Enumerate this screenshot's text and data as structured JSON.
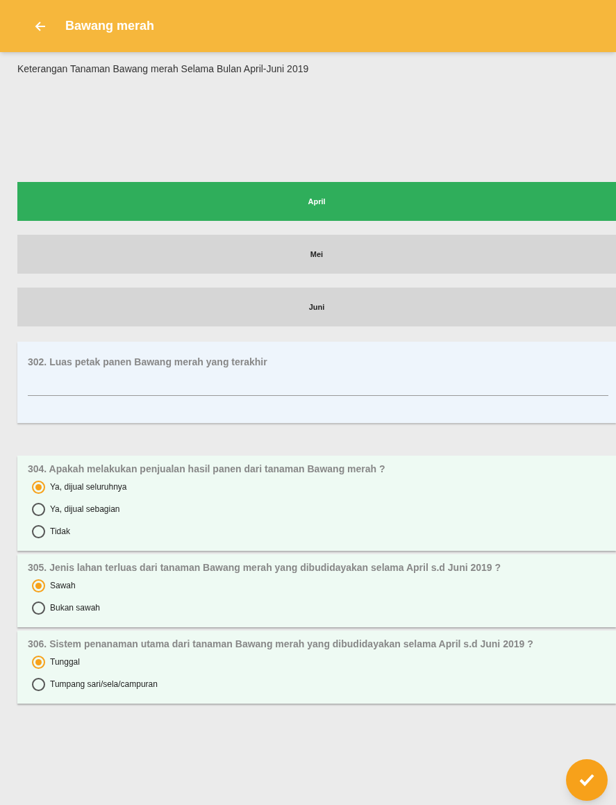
{
  "app_bar": {
    "title": "Bawang merah"
  },
  "description": "Keterangan Tanaman Bawang merah Selama Bulan April-Juni 2019",
  "months": [
    {
      "label": "April",
      "selected": true
    },
    {
      "label": "Mei",
      "selected": false
    },
    {
      "label": "Juni",
      "selected": false
    }
  ],
  "questions": [
    {
      "kind": "text",
      "label": "302. Luas petak panen Bawang merah yang terakhir"
    },
    {
      "kind": "radio",
      "label": "304. Apakah melakukan penjualan hasil panen dari tanaman Bawang merah ?",
      "options": [
        {
          "label": "Ya, dijual seluruhnya",
          "selected": true
        },
        {
          "label": "Ya, dijual sebagian",
          "selected": false
        },
        {
          "label": "Tidak",
          "selected": false
        }
      ]
    },
    {
      "kind": "radio",
      "label": "305. Jenis lahan terluas dari tanaman Bawang merah yang dibudidayakan selama April s.d Juni 2019 ?",
      "options": [
        {
          "label": "Sawah",
          "selected": true
        },
        {
          "label": "Bukan sawah",
          "selected": false
        }
      ]
    },
    {
      "kind": "radio",
      "label": "306. Sistem penanaman utama dari tanaman Bawang merah yang dibudidayakan selama April s.d Juni 2019 ?",
      "options": [
        {
          "label": "Tunggal",
          "selected": true
        },
        {
          "label": "Tumpang sari/sela/campuran",
          "selected": false
        }
      ]
    }
  ]
}
